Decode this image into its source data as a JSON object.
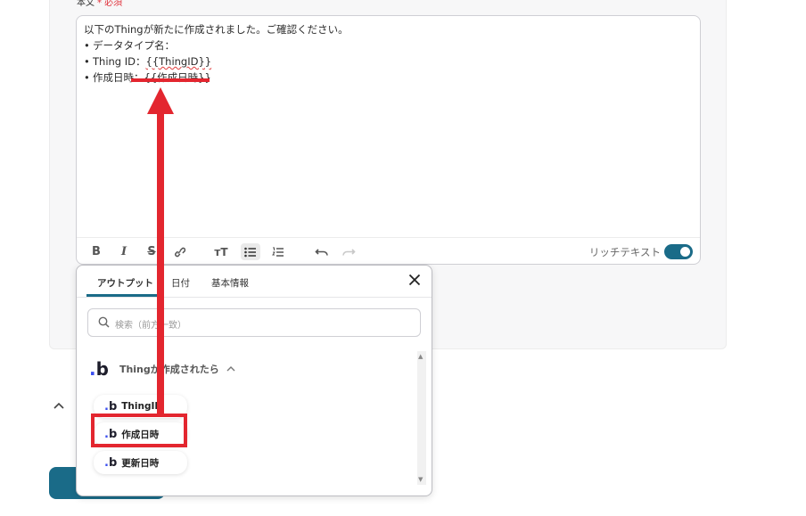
{
  "field": {
    "label": "本文",
    "required": "* 必須"
  },
  "editor": {
    "intro": "以下のThingが新たに作成されました。ご確認ください。",
    "lines": [
      {
        "prefix": "データタイプ名：",
        "token": ""
      },
      {
        "prefix": "Thing ID：",
        "token": "{{ThingID}}"
      },
      {
        "prefix": "作成日時：",
        "token": "{{作成日時}}"
      }
    ],
    "rich_text_label": "リッチテキスト",
    "rich_text_enabled": true
  },
  "toolbar_icons": [
    "bold-icon",
    "italic-icon",
    "strikethrough-icon",
    "link-icon",
    "text-size-icon",
    "bullet-list-icon",
    "numbered-list-icon",
    "undo-icon",
    "redo-icon"
  ],
  "popup": {
    "tabs": [
      {
        "label": "アウトプット",
        "active": true
      },
      {
        "label": "日付",
        "active": false
      },
      {
        "label": "基本情報",
        "active": false
      }
    ],
    "search_placeholder": "検索（前方一致）",
    "group_title": "Thingが作成されたら",
    "items": [
      {
        "label": "ThingID"
      },
      {
        "label": "作成日時"
      },
      {
        "label": "更新日時"
      }
    ]
  },
  "colors": {
    "accent": "#1a6b88",
    "annotation": "#e3262f",
    "logo_dot": "#3a4ef0"
  }
}
